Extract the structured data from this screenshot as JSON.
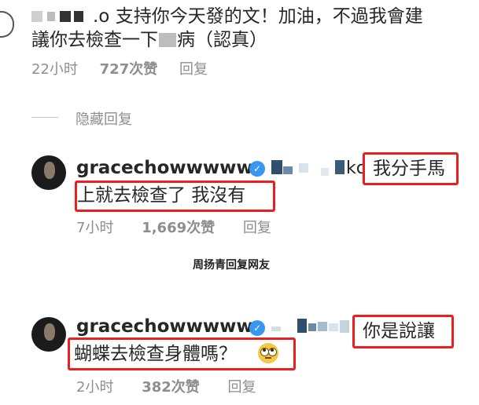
{
  "comment_top": {
    "text_line1": ".o 支持你今天發的文！加油，不過我會建",
    "text_line2_a": "議你去檢查一下",
    "text_line2_b": "病（認真）",
    "time": "22小时",
    "likes": "727次赞",
    "reply_label": "回复"
  },
  "hide_replies": {
    "label": "隐藏回复"
  },
  "reply1": {
    "username": "gracechowwwww",
    "mention_tail": "kc",
    "text_boxed_1": "我分手馬",
    "text_line2": "上就去檢查了 我沒有",
    "time": "7小时",
    "likes": "1,669次赞",
    "reply_label": "回复"
  },
  "caption": {
    "text": "周扬青回复网友"
  },
  "reply2": {
    "username": "gracechowwwww",
    "text_boxed_1": "你是說讓",
    "text_line2": "蝴蝶去檢查身體嗎？",
    "time": "2小时",
    "likes": "382次赞",
    "reply_label": "回复"
  },
  "icons": {
    "verified": "verified-badge-icon",
    "emoji": "face-with-rolling-eyes-icon"
  },
  "colors": {
    "highlight_box": "#e8201f",
    "verified": "#3897f0",
    "meta_text": "#8e8e8e"
  }
}
